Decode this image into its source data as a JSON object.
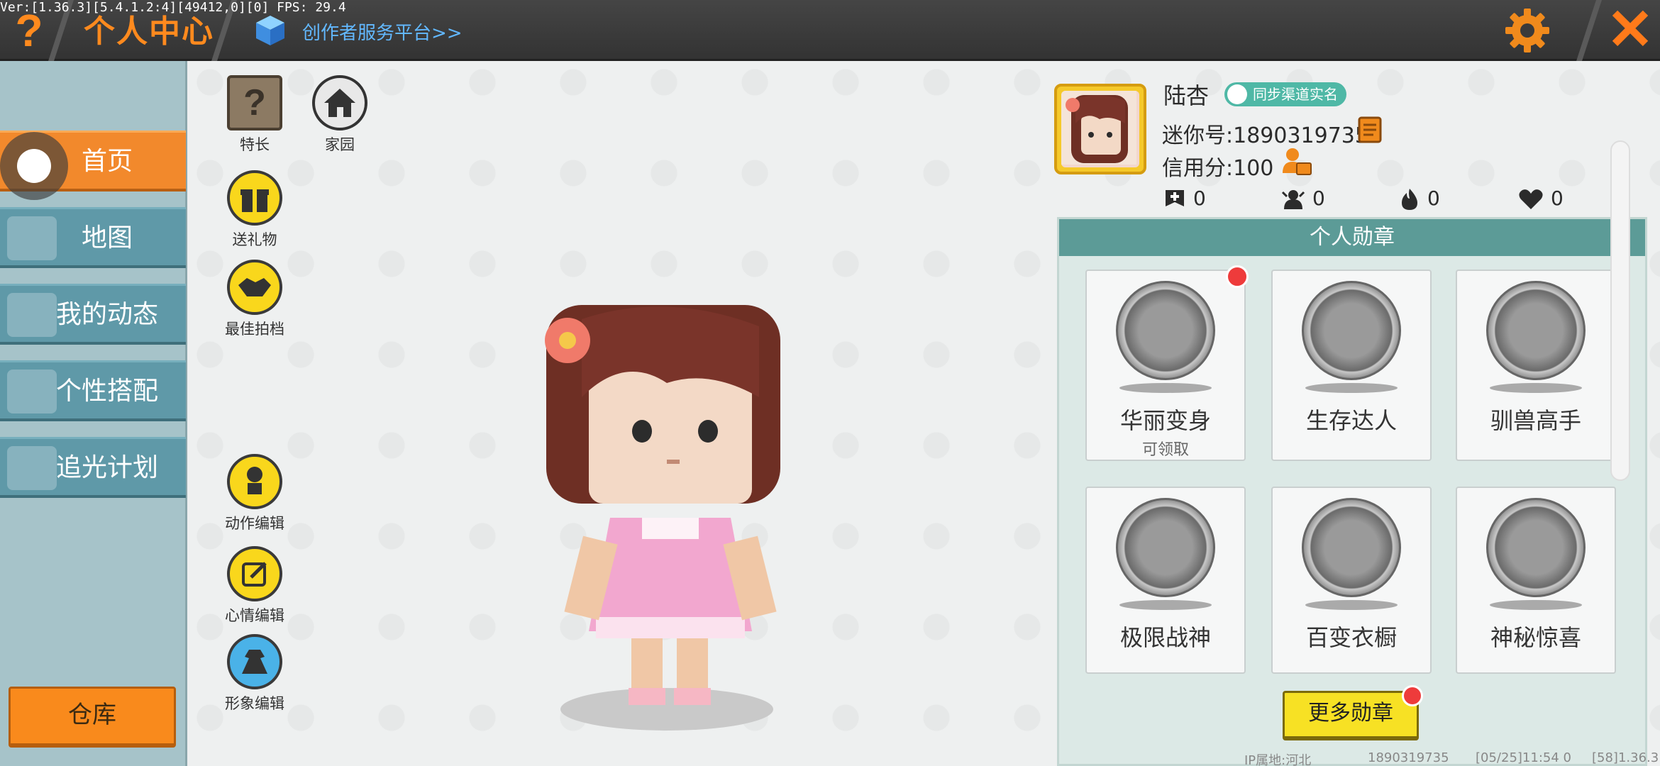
{
  "debug": {
    "version_text": "Ver:[1.36.3][5.4.1.2:4][49412,0][0] FPS: 29.4"
  },
  "topbar": {
    "help_icon": "?",
    "title": "个人中心",
    "creator_link": "创作者服务平台>>",
    "close_icon": "✕"
  },
  "sidebar": {
    "items": [
      {
        "label": "首页",
        "active": true
      },
      {
        "label": "地图",
        "active": false
      },
      {
        "label": "我的动态",
        "active": false
      },
      {
        "label": "个性搭配",
        "active": false
      },
      {
        "label": "追光计划",
        "active": false
      }
    ],
    "warehouse": "仓库"
  },
  "actions": {
    "specialty": "特长",
    "home": "家园",
    "gift": "送礼物",
    "partner": "最佳拍档",
    "action_edit": "动作编辑",
    "mood_edit": "心情编辑",
    "image_edit": "形象编辑"
  },
  "profile": {
    "name": "陆杏",
    "realname_badge": "同步渠道实名",
    "mini_id": "迷你号:1890319735",
    "credit": "信用分:100",
    "stats": [
      {
        "icon": "add-friend-icon",
        "value": "0"
      },
      {
        "icon": "fans-icon",
        "value": "0"
      },
      {
        "icon": "fire-icon",
        "value": "0"
      },
      {
        "icon": "heart-icon",
        "value": "0"
      }
    ]
  },
  "medals": {
    "header": "个人勋章",
    "items": [
      {
        "name": "华丽变身",
        "sub": "可领取",
        "has_dot": true
      },
      {
        "name": "生存达人",
        "sub": "",
        "has_dot": false
      },
      {
        "name": "驯兽高手",
        "sub": "",
        "has_dot": false
      },
      {
        "name": "极限战神",
        "sub": "",
        "has_dot": false
      },
      {
        "name": "百变衣橱",
        "sub": "",
        "has_dot": false
      },
      {
        "name": "神秘惊喜",
        "sub": "",
        "has_dot": false
      }
    ],
    "more_button": "更多勋章"
  },
  "footer": {
    "ip_location": "IP属地:河北",
    "uid": "1890319735",
    "time": "[05/25]11:54 0",
    "version": "[58]1.36.3"
  },
  "colors": {
    "accent_orange": "#f2892c",
    "sidebar_blue": "#5f99a8",
    "medal_teal": "#5c9b97",
    "button_yellow": "#f7e124"
  }
}
